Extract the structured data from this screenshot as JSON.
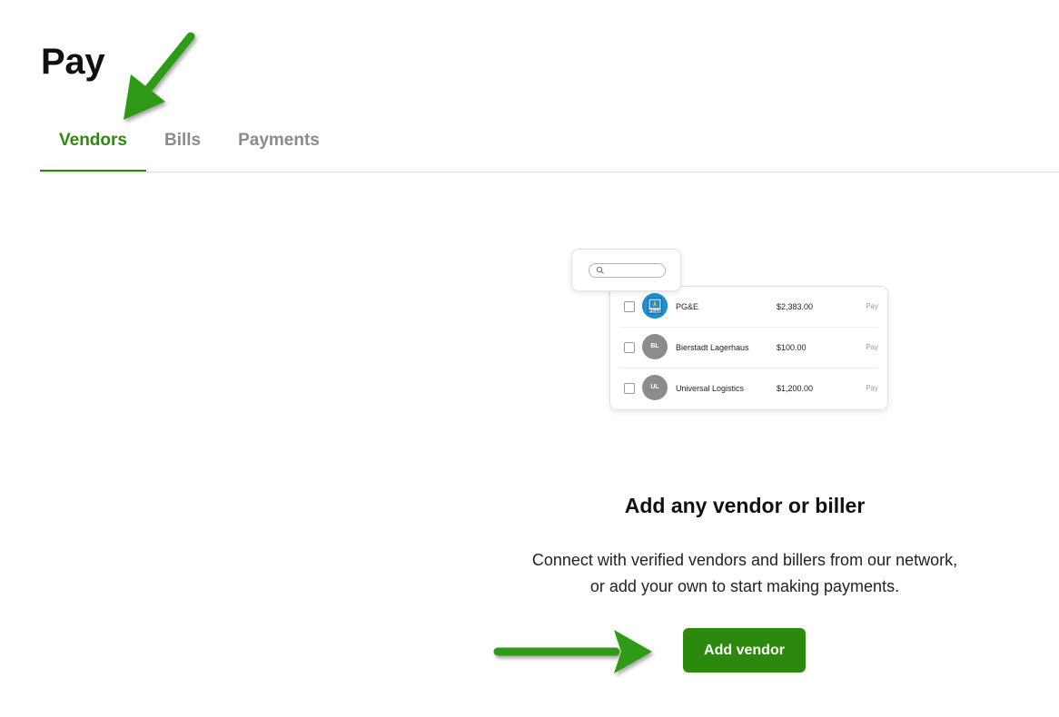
{
  "header": {
    "title": "Pay"
  },
  "tabs": [
    {
      "label": "Vendors",
      "active": true
    },
    {
      "label": "Bills",
      "active": false
    },
    {
      "label": "Payments",
      "active": false
    }
  ],
  "illustration": {
    "vendors": [
      {
        "avatar": "PG&E",
        "name": "PG&E",
        "amount": "$2,383.00",
        "action": "Pay",
        "logo": true
      },
      {
        "avatar": "BL",
        "name": "Bierstadt Lagerhaus",
        "amount": "$100.00",
        "action": "Pay",
        "logo": false
      },
      {
        "avatar": "UL",
        "name": "Universal Logistics",
        "amount": "$1,200.00",
        "action": "Pay",
        "logo": false
      }
    ]
  },
  "empty_state": {
    "title": "Add any vendor or biller",
    "description_line1": "Connect with verified vendors and billers from our network,",
    "description_line2": "or add your own to start making payments.",
    "button_label": "Add vendor"
  },
  "colors": {
    "accent": "#2b8a0e",
    "tab_inactive": "#8b8b8b",
    "annotation_arrow": "#2e9a17"
  }
}
